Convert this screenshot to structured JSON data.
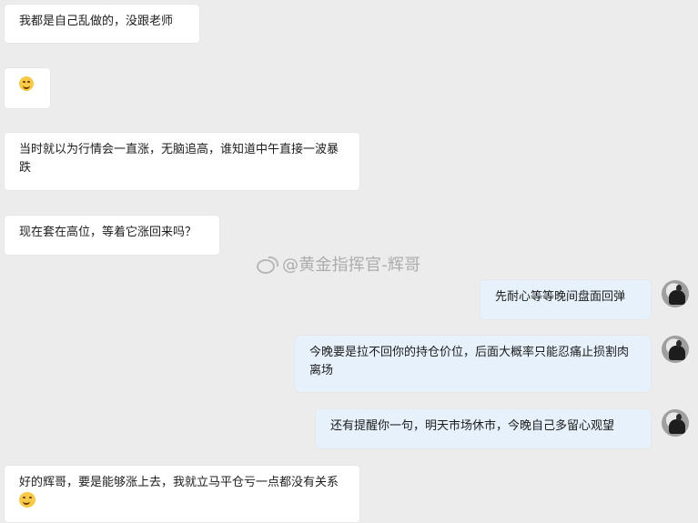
{
  "messages": [
    {
      "text": "我都是自己乱做的，没跟老师"
    },
    {
      "text": ""
    },
    {
      "text": "当时就以为行情会一直涨，无脑追高，谁知道中午直接一波暴跌"
    },
    {
      "text": "现在套在高位，等着它涨回来吗？"
    },
    {
      "text": "先耐心等等晚间盘面回弹"
    },
    {
      "text": "今晚要是拉不回你的持仓价位，后面大概率只能忍痛止损割肉离场"
    },
    {
      "text": "还有提醒你一句，明天市场休市，今晚自己多留心观望"
    },
    {
      "text": "好的辉哥，要是能够涨上去，我就立马平仓亏一点都没有关系"
    }
  ],
  "watermark": {
    "text": "@黄金指挥官-辉哥"
  },
  "icons": {
    "avatar": "user-avatar",
    "emoji": "laughing-face-icon",
    "watermark": "weibo-icon"
  }
}
